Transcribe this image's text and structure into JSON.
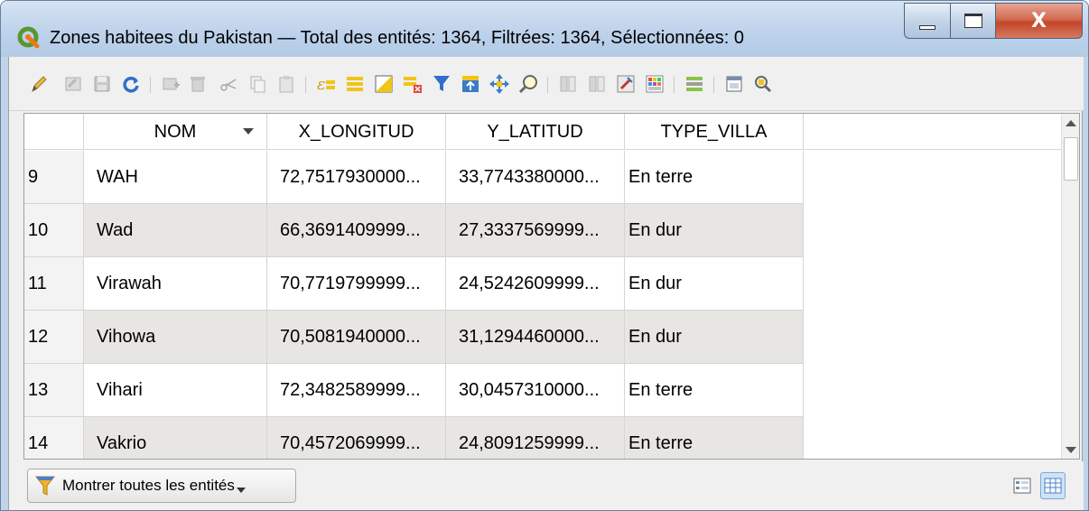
{
  "window": {
    "title": "Zones habitees du Pakistan — Total des entités: 1364, Filtrées: 1364, Sélectionnées: 0",
    "controls": {
      "minimize": "minimize",
      "maximize": "maximize",
      "close_glyph": "X"
    }
  },
  "colors": {
    "titlebar": "#bfd3ea",
    "row_alt": "#e8e6e2",
    "qgis_green": "#589632",
    "close_red": "#c3452a"
  },
  "toolbar": {
    "icons": [
      "pencil-icon",
      "multi-edit-icon",
      "save-edits-icon",
      "reload-icon",
      "add-feature-icon",
      "delete-feature-icon",
      "cut-icon",
      "copy-icon",
      "paste-icon",
      "expression-select-icon",
      "select-all-icon",
      "invert-selection-icon",
      "deselect-all-icon",
      "filter-map-icon",
      "move-selection-top-icon",
      "pan-to-selection-icon",
      "zoom-to-selection-icon",
      "new-field-icon",
      "delete-field-icon",
      "field-calculator-icon",
      "conditional-formatting-icon",
      "organize-columns-icon",
      "dock-icon",
      "actions-icon"
    ]
  },
  "table": {
    "columns": [
      {
        "label": "NOM",
        "sorted": "descending"
      },
      {
        "label": "X_LONGITUD"
      },
      {
        "label": "Y_LATITUD"
      },
      {
        "label": "TYPE_VILLA"
      }
    ],
    "rows": [
      {
        "idx": "9",
        "nom": "WAH",
        "x": "72,7517930000...",
        "y": "33,7743380000...",
        "type": "En terre"
      },
      {
        "idx": "10",
        "nom": "Wad",
        "x": "66,3691409999...",
        "y": "27,3337569999...",
        "type": "En dur"
      },
      {
        "idx": "11",
        "nom": "Virawah",
        "x": "70,7719799999...",
        "y": "24,5242609999...",
        "type": "En dur"
      },
      {
        "idx": "12",
        "nom": "Vihowa",
        "x": "70,5081940000...",
        "y": "31,1294460000...",
        "type": "En dur"
      },
      {
        "idx": "13",
        "nom": "Vihari",
        "x": "72,3482589999...",
        "y": "30,0457310000...",
        "type": "En terre"
      },
      {
        "idx": "14",
        "nom": "Vakrio",
        "x": "70,4572069999...",
        "y": "24,8091259999...",
        "type": "En terre"
      }
    ]
  },
  "bottom": {
    "filter_button": "Montrer toutes les entités",
    "view_buttons": [
      "form-view-icon",
      "table-view-icon"
    ]
  }
}
